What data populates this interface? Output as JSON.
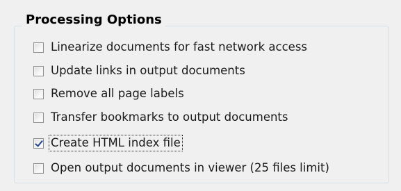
{
  "group": {
    "title": "Processing Options"
  },
  "options": [
    {
      "label": "Linearize documents for fast network access",
      "checked": false
    },
    {
      "label": "Update links in output documents",
      "checked": false
    },
    {
      "label": "Remove all page labels",
      "checked": false
    },
    {
      "label": "Transfer bookmarks to output documents",
      "checked": false
    },
    {
      "label": "Create HTML index file",
      "checked": true
    },
    {
      "label": "Open output documents in viewer (25 files limit)",
      "checked": false
    }
  ]
}
